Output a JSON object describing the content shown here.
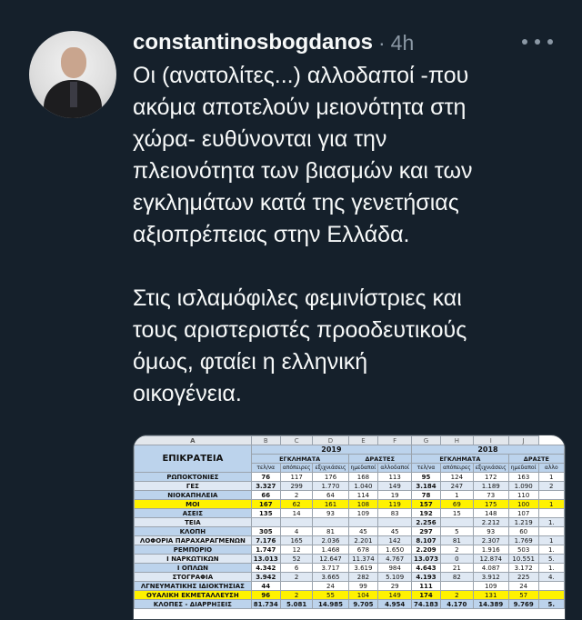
{
  "post": {
    "username": "constantinosbogdanos",
    "separator": "·",
    "time": "4h",
    "lines": [
      "Οι (ανατολίτες...) αλλοδαποί -που",
      "ακόμα αποτελούν μειονότητα στη",
      "χώρα- ευθύνονται για την",
      "πλειονότητα των βιασμών και των",
      "εγκλημάτων κατά της γενετήσιας",
      "αξιοπρέπειας στην Ελλάδα."
    ],
    "lines2": [
      "Στις ισλαμόφιλες φεμινίστριες και",
      "τους αριστεριστές προοδευτικούς",
      "όμως, φταίει η ελληνική",
      "οικογένεια."
    ]
  },
  "icons": {
    "avatar": "profile-photo",
    "more": "more-horizontal-icon"
  },
  "colors": {
    "background": "#15202b",
    "text": "#f7f9f9",
    "muted": "#8b98a5",
    "highlight": "#fff200",
    "header_blue": "#bcd3ec"
  },
  "sheet": {
    "col_letters": [
      "A",
      "B",
      "C",
      "D",
      "E",
      "F",
      "G",
      "H",
      "I",
      "J"
    ],
    "title": "ΕΠΙΚΡΑΤΕΙΑ",
    "year1": "2019",
    "year2": "2018",
    "group_crimes": "ΕΓΚΛΗΜΑΤΑ",
    "group_perps": "ΔΡΑΣΤΕΣ",
    "group_crimes2": "ΕΓΚΛΗΜΑΤΑ",
    "group_perps2": "ΔΡΑΣΤΕ",
    "subheaders": [
      "τελ/να",
      "απόπειρες",
      "εξιχνιάσεις",
      "ημεδαποί",
      "αλλοδαποί",
      "τελ/να",
      "απόπειρες",
      "εξιχνιάσεις",
      "ημεδαποί",
      "αλλο"
    ],
    "rows": [
      {
        "label": "ΡΩΠΟΚΤΟΝΙΕΣ",
        "cells": [
          "76",
          "117",
          "176",
          "168",
          "113",
          "95",
          "124",
          "172",
          "163",
          "1"
        ]
      },
      {
        "label": "ΓΕΣ",
        "cells": [
          "3.327",
          "299",
          "1.770",
          "1.040",
          "149",
          "3.184",
          "247",
          "1.189",
          "1.090",
          "2"
        ]
      },
      {
        "label": "ΝΙΟΚΑΠΗΛΕΙΑ",
        "cells": [
          "66",
          "2",
          "64",
          "114",
          "19",
          "78",
          "1",
          "73",
          "110",
          ""
        ]
      },
      {
        "label": "ΜΟΙ",
        "cells": [
          "167",
          "62",
          "161",
          "108",
          "119",
          "157",
          "69",
          "175",
          "100",
          "1"
        ],
        "highlight": true
      },
      {
        "label": "ΑΣΕΙΣ",
        "cells": [
          "135",
          "14",
          "93",
          "109",
          "83",
          "192",
          "15",
          "148",
          "107",
          ""
        ]
      },
      {
        "label": "ΤΕΙΑ",
        "cells": [
          "",
          "",
          "",
          "",
          "",
          "2.256",
          "",
          "2.212",
          "1.219",
          "1."
        ]
      },
      {
        "label": "ΚΛΟΠΗ",
        "cells": [
          "305",
          "4",
          "81",
          "45",
          "45",
          "297",
          "5",
          "93",
          "60",
          ""
        ]
      },
      {
        "label": "ΛΟΦΟΡΙΑ ΠΑΡΑΧΑΡΑΓΜΕΝΩΝ",
        "cells": [
          "7.176",
          "165",
          "2.036",
          "2.201",
          "142",
          "8.107",
          "81",
          "2.307",
          "1.769",
          "1"
        ]
      },
      {
        "label": "ΡΕΜΠΟΡΙΟ",
        "cells": [
          "1.747",
          "12",
          "1.468",
          "678",
          "1.650",
          "2.209",
          "2",
          "1.916",
          "503",
          "1."
        ]
      },
      {
        "label": "Ι ΝΑΡΚΩΤΙΚΩΝ",
        "cells": [
          "13.013",
          "52",
          "12.647",
          "11.374",
          "4.767",
          "13.073",
          "0",
          "12.874",
          "10.551",
          "5."
        ]
      },
      {
        "label": "Ι ΟΠΛΩΝ",
        "cells": [
          "4.342",
          "6",
          "3.717",
          "3.619",
          "984",
          "4.643",
          "21",
          "4.087",
          "3.172",
          "1."
        ]
      },
      {
        "label": "ΣΤΟΓΡΑΦΙΑ",
        "cells": [
          "3.942",
          "2",
          "3.665",
          "282",
          "5.109",
          "4.193",
          "82",
          "3.912",
          "225",
          "4."
        ]
      },
      {
        "label": "ΛΓΝΕΥΜΑΤΙΚΗΣ ΙΔΙΟΚΤΗΣΙΑΣ",
        "cells": [
          "44",
          "",
          "24",
          "99",
          "29",
          "111",
          "",
          "109",
          "24",
          ""
        ]
      },
      {
        "label": "ΟΥΑΛΙΚΗ ΕΚΜΕΤΑΛΛΕΥΣΗ",
        "cells": [
          "96",
          "2",
          "55",
          "104",
          "149",
          "174",
          "2",
          "131",
          "57",
          ""
        ],
        "highlight": true
      }
    ],
    "total_label": "ΚΛΟΠΕΣ - ΔΙΑΡΡΗΞΕΙΣ",
    "total_cells": [
      "81.734",
      "5.081",
      "14.985",
      "9.705",
      "4.954",
      "74.183",
      "4.170",
      "14.389",
      "9.769",
      "5."
    ]
  }
}
